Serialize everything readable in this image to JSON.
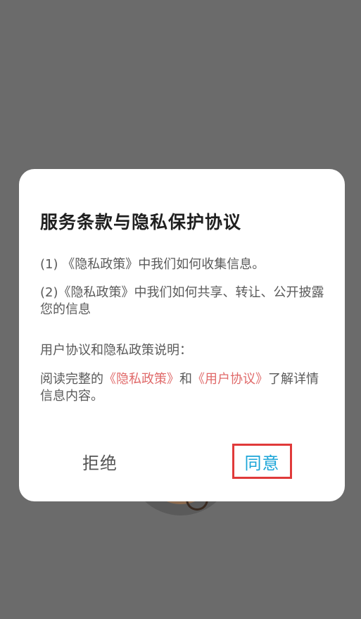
{
  "dialog": {
    "title": "服务条款与隐私保护协议",
    "item1": "(1) 《隐私政策》中我们如何收集信息。",
    "item2": "(2)《隐私政策》中我们如何共享、转让、公开披露您的信息",
    "section_label": "用户协议和隐私政策说明：",
    "read_prefix": "阅读完整的",
    "privacy_link": "《隐私政策》",
    "and_text": "和",
    "user_agreement_link": "《用户协议》",
    "read_suffix": "了解详情信息内容。",
    "reject_label": "拒绝",
    "agree_label": "同意"
  },
  "colors": {
    "overlay": "#6b6b6b",
    "link": "#e06a6a",
    "agree_text": "#1aa5d8",
    "highlight_border": "#e03a3a"
  }
}
